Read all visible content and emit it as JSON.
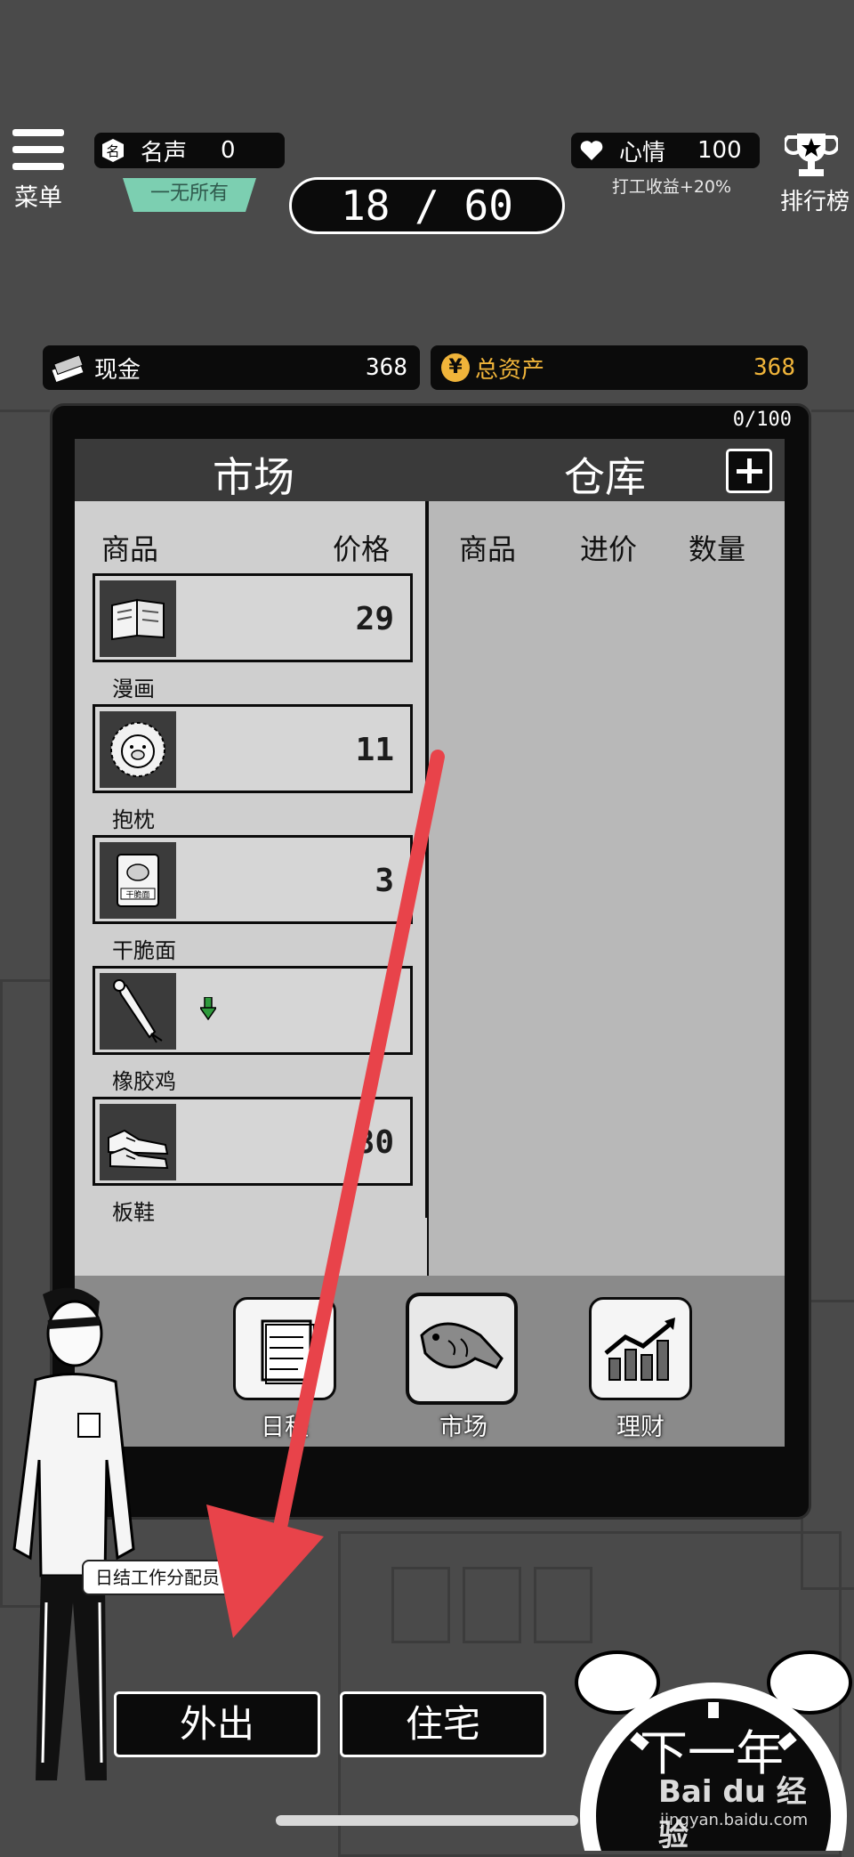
{
  "header": {
    "menu_label": "菜单",
    "fame_label": "名声",
    "fame_value": "0",
    "rank_title": "一无所有",
    "day_counter": "18 / 60",
    "mood_label": "心情",
    "mood_value": "100",
    "mood_bonus": "打工收益+20%",
    "leaderboard_label": "排行榜"
  },
  "finance": {
    "cash_label": "现金",
    "cash_value": "368",
    "assets_label": "总资产",
    "assets_value": "368",
    "assets_color": "#f0b43a"
  },
  "panel": {
    "capacity": "0/100",
    "market_title": "市场",
    "warehouse_title": "仓库",
    "market_columns": [
      "商品",
      "价格"
    ],
    "warehouse_columns": [
      "商品",
      "进价",
      "数量"
    ],
    "items": [
      {
        "name": "漫画",
        "price": "29",
        "icon": "comic-book-icon"
      },
      {
        "name": "抱枕",
        "price": "11",
        "icon": "pillow-icon"
      },
      {
        "name": "干脆面",
        "price": "3",
        "icon": "instant-noodle-icon"
      },
      {
        "name": "橡胶鸡",
        "price": "",
        "icon": "rubber-chicken-icon",
        "trend": "down"
      },
      {
        "name": "板鞋",
        "price": "80",
        "icon": "sneakers-icon"
      }
    ]
  },
  "bottom_nav": {
    "schedule_label": "日程",
    "market_label": "市场",
    "finance_label": "理财"
  },
  "footer": {
    "speech_text": "日结工作分配员",
    "go_out_label": "外出",
    "home_label": "住宅",
    "next_year_label": "下一年"
  },
  "watermark": {
    "brand": "Bai du 经验",
    "url": "jingyan.baidu.com"
  },
  "colors": {
    "background": "#4a4a4a",
    "annotation_arrow": "#e8434a",
    "rank_badge": "#7ccfb1",
    "trend_down": "#2e9a3c"
  }
}
